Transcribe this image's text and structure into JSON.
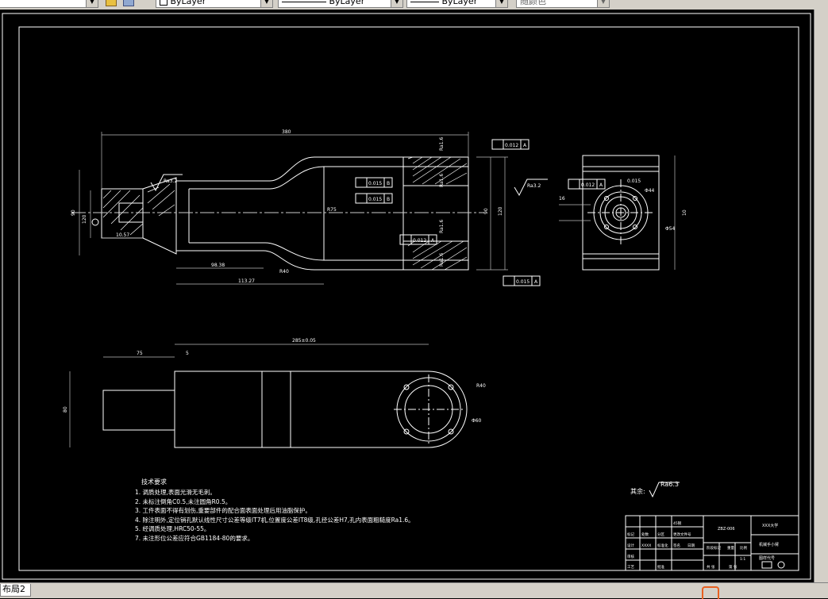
{
  "toolbar": {
    "layer_value": "ByLayer",
    "linetype_value": "ByLayer",
    "lineweight_value": "ByLayer",
    "color_value": "随颜色"
  },
  "layout_tab": "布局2",
  "drawing": {
    "dims": {
      "d380": "380",
      "d90a": "90",
      "d120a": "120",
      "d10757": "10.57",
      "d9838": "98.38",
      "d11327": "113.27",
      "r40": "R40",
      "r75": "R75",
      "d90b": "90",
      "d120b": "120",
      "d75": "75",
      "d5": "5",
      "d285": "285±0.05",
      "d80": "80",
      "r40b": "R40",
      "phi60": "Φ60",
      "phi44": "Φ44",
      "phi54": "Φ54",
      "d16": "16",
      "d10": "10"
    },
    "tolerances": {
      "t1": "0.015",
      "t1ref": "B",
      "t2": "0.015",
      "t2ref": "B",
      "t3": "0.012",
      "t3ref": "A",
      "t4": "0.012",
      "t4ref": "A",
      "t5": "0.015",
      "t5ref": "A",
      "t6": "0.012",
      "t6ref": "A",
      "t7": "0.015",
      "t7ref": "A"
    },
    "roughness": {
      "r1": "Ra1.6",
      "r2": "Ra1.6",
      "r3": "Ra1.6",
      "r4": "Ra1.6",
      "r5": "Ra3.2",
      "r6": "Ra3.2",
      "rest_label": "其余:",
      "rest_value": "Ra6.3"
    }
  },
  "requirements": {
    "title": "技术要求",
    "items": [
      "1. 调质处理,表面光滑无毛刺。",
      "2. 未标注倒角C0.5,未注圆角R0.5。",
      "3. 工件表面不得有划伤,重要部件的配合面表面处理后用油脂保护。",
      "4. 除注明外,定位销孔默认线性尺寸公差等级IT7机,位置度公差IT8级,孔径公差H7,孔内表面粗糙度Ra1.6。",
      "5. 经调质处理,HRC50-55。",
      "7. 未注形位公差应符合GB1184-80的要求。"
    ]
  },
  "title_block": {
    "part_code": "ZBZ-006",
    "school": "XXX大学",
    "part_name": "机械手小臂",
    "scale_label": "比例",
    "scale": "1:1",
    "mark_label": "阶段标记",
    "weight_label": "重量",
    "sheet_label": "共 张",
    "sheet_of": "第 张",
    "designer_label": "设计",
    "checker_label": "审核",
    "process_label": "工艺",
    "approve_label": "批准",
    "std_label": "标准化",
    "date_label": "日期",
    "sign_label": "签名",
    "change_label": "更改文件号",
    "zone_label": "分区",
    "count_label": "处数",
    "mark2_label": "标记",
    "material": "45钢",
    "designer": "XXXX",
    "projection": "图样代号"
  }
}
